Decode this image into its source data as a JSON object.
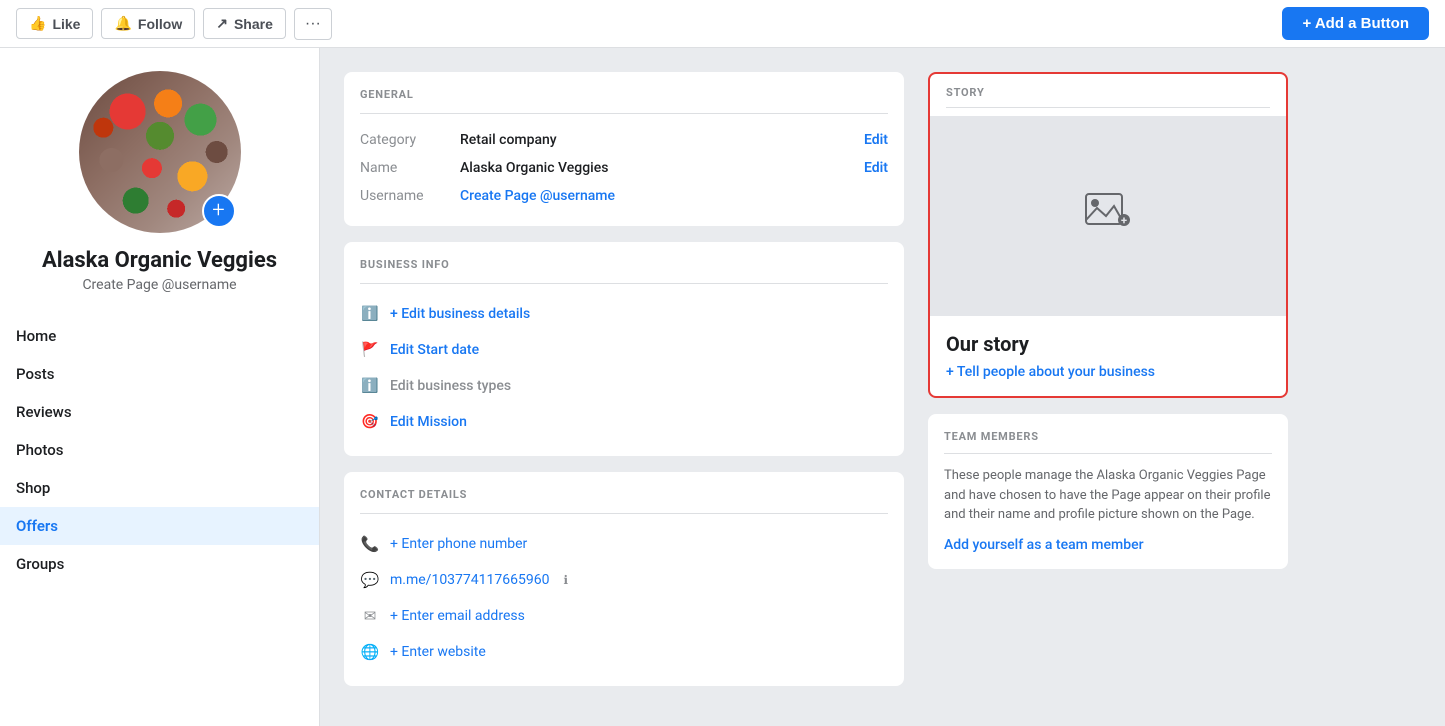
{
  "topbar": {
    "like_label": "Like",
    "follow_label": "Follow",
    "share_label": "Share",
    "more_label": "···",
    "add_button_label": "+ Add a Button"
  },
  "sidebar": {
    "page_name": "Alaska Organic Veggies",
    "page_username": "Create Page @username",
    "add_photo_label": "+",
    "nav_items": [
      {
        "label": "Home",
        "active": false
      },
      {
        "label": "Posts",
        "active": false
      },
      {
        "label": "Reviews",
        "active": false
      },
      {
        "label": "Photos",
        "active": false
      },
      {
        "label": "Shop",
        "active": false
      },
      {
        "label": "Offers",
        "active": true
      },
      {
        "label": "Groups",
        "active": false
      }
    ]
  },
  "general": {
    "section_title": "GENERAL",
    "category_label": "Category",
    "category_value": "Retail company",
    "category_edit": "Edit",
    "name_label": "Name",
    "name_value": "Alaska Organic Veggies",
    "name_edit": "Edit",
    "username_label": "Username",
    "username_link": "Create Page @username"
  },
  "business_info": {
    "section_title": "BUSINESS INFO",
    "edit_details_label": "+ Edit business details",
    "edit_startdate_label": "Edit Start date",
    "edit_types_label": "Edit business types",
    "edit_mission_label": "Edit Mission"
  },
  "contact_details": {
    "section_title": "CONTACT DETAILS",
    "phone_label": "+ Enter phone number",
    "messenger_link": "m.me/103774117665960",
    "email_label": "+ Enter email address",
    "website_label": "+ Enter website"
  },
  "story": {
    "section_title": "STORY",
    "image_icon": "🖼",
    "content_title": "Our story",
    "content_link": "+ Tell people about your business"
  },
  "team_members": {
    "section_title": "TEAM MEMBERS",
    "description": "These people manage the Alaska Organic Veggies Page and have chosen to have the Page appear on their profile and their name and profile picture shown on the Page.",
    "add_link": "Add yourself as a team member"
  }
}
